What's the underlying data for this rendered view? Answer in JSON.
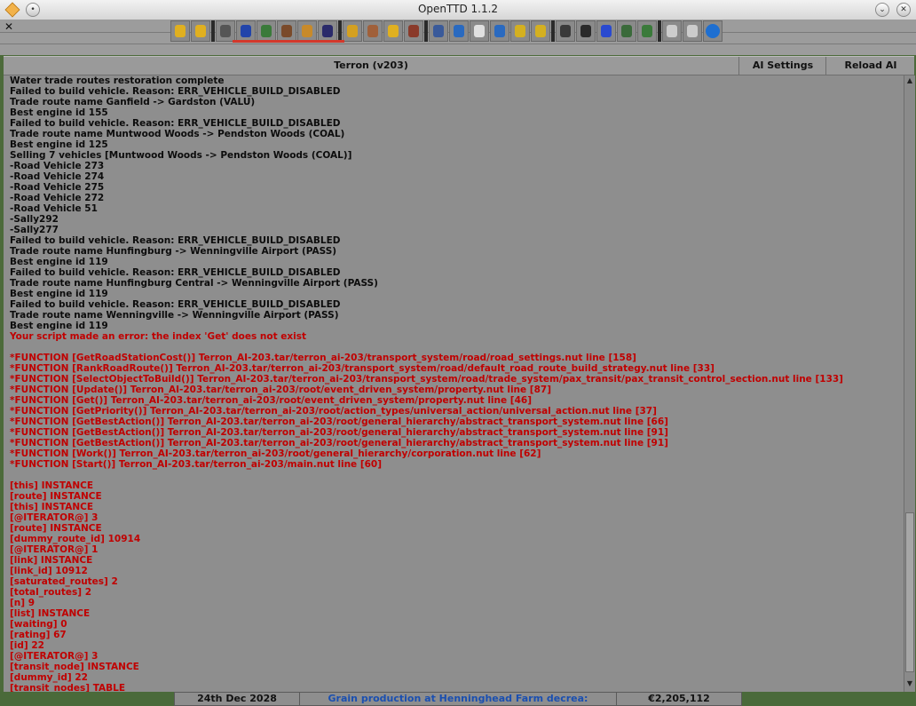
{
  "window": {
    "title": "OpenTTD 1.1.2"
  },
  "toolbar": {
    "icons": [
      {
        "name": "pause-icon",
        "color": "#e0b020"
      },
      {
        "name": "fast-forward-icon",
        "color": "#e0b020"
      },
      {
        "name": "settings-gear-icon",
        "color": "#555555"
      },
      {
        "name": "save-disk-icon",
        "color": "#2244aa"
      },
      {
        "name": "minimap-icon",
        "color": "#3a7a3a"
      },
      {
        "name": "town-directory-icon",
        "color": "#7a4a2a"
      },
      {
        "name": "subsidies-icon",
        "color": "#c88a2a"
      },
      {
        "name": "station-list-icon",
        "color": "#2a2a6a"
      },
      {
        "name": "finances-icon",
        "color": "#d4a020"
      },
      {
        "name": "company-face-icon",
        "color": "#a0603a"
      },
      {
        "name": "league-trophy-icon",
        "color": "#e0b020"
      },
      {
        "name": "industry-icon",
        "color": "#8a3a2a"
      },
      {
        "name": "train-list-icon",
        "color": "#3a5a9a"
      },
      {
        "name": "road-vehicle-list-icon",
        "color": "#2a6ac0"
      },
      {
        "name": "ship-list-icon",
        "color": "#e0e0e0"
      },
      {
        "name": "aircraft-list-icon",
        "color": "#2a6ac0"
      },
      {
        "name": "zoom-in-icon",
        "color": "#d4b020"
      },
      {
        "name": "zoom-out-icon",
        "color": "#d4b020"
      },
      {
        "name": "build-rail-icon",
        "color": "#3a3a3a"
      },
      {
        "name": "build-road-icon",
        "color": "#2a2a2a"
      },
      {
        "name": "build-water-icon",
        "color": "#2a4ad0"
      },
      {
        "name": "build-air-icon",
        "color": "#3a6a3a"
      },
      {
        "name": "landscaping-icon",
        "color": "#3a7a3a"
      },
      {
        "name": "music-icon",
        "color": "#cccccc"
      },
      {
        "name": "messages-icon",
        "color": "#cccccc"
      },
      {
        "name": "help-icon",
        "color": "#1e6fd1"
      }
    ]
  },
  "ai_debug": {
    "company_tab": "Terron (v203)",
    "ai_settings_label": "AI Settings",
    "reload_ai_label": "Reload AI",
    "log": [
      {
        "text": "Water trade routes restoration complete",
        "err": false
      },
      {
        "text": "Failed to build vehicle. Reason: ERR_VEHICLE_BUILD_DISABLED",
        "err": false
      },
      {
        "text": "Trade route name Ganfield -> Gardston (VALU)",
        "err": false
      },
      {
        "text": "Best engine id 155",
        "err": false
      },
      {
        "text": "Failed to build vehicle. Reason: ERR_VEHICLE_BUILD_DISABLED",
        "err": false
      },
      {
        "text": "Trade route name Muntwood Woods -> Pendston Woods (COAL)",
        "err": false
      },
      {
        "text": "Best engine id 125",
        "err": false
      },
      {
        "text": "Selling 7 vehicles [Muntwood Woods -> Pendston Woods (COAL)]",
        "err": false
      },
      {
        "text": "-Road Vehicle 273",
        "err": false
      },
      {
        "text": "-Road Vehicle 274",
        "err": false
      },
      {
        "text": "-Road Vehicle 275",
        "err": false
      },
      {
        "text": "-Road Vehicle 272",
        "err": false
      },
      {
        "text": "-Road Vehicle 51",
        "err": false
      },
      {
        "text": "-Sally292",
        "err": false
      },
      {
        "text": "-Sally277",
        "err": false
      },
      {
        "text": "Failed to build vehicle. Reason: ERR_VEHICLE_BUILD_DISABLED",
        "err": false
      },
      {
        "text": "Trade route name Hunfingburg -> Wenningville Airport (PASS)",
        "err": false
      },
      {
        "text": "Best engine id 119",
        "err": false
      },
      {
        "text": "Failed to build vehicle. Reason: ERR_VEHICLE_BUILD_DISABLED",
        "err": false
      },
      {
        "text": "Trade route name Hunfingburg Central -> Wenningville Airport (PASS)",
        "err": false
      },
      {
        "text": "Best engine id 119",
        "err": false
      },
      {
        "text": "Failed to build vehicle. Reason: ERR_VEHICLE_BUILD_DISABLED",
        "err": false
      },
      {
        "text": "Trade route name Wenningville -> Wenningville Airport (PASS)",
        "err": false
      },
      {
        "text": "Best engine id 119",
        "err": false
      },
      {
        "text": "Your script made an error: the index 'Get' does not exist",
        "err": true
      },
      {
        "text": "",
        "err": true
      },
      {
        "text": "*FUNCTION [GetRoadStationCost()] Terron_AI-203.tar/terron_ai-203/transport_system/road/road_settings.nut line [158]",
        "err": true
      },
      {
        "text": "*FUNCTION [RankRoadRoute()] Terron_AI-203.tar/terron_ai-203/transport_system/road/default_road_route_build_strategy.nut line [33]",
        "err": true
      },
      {
        "text": "*FUNCTION [SelectObjectToBuild()] Terron_AI-203.tar/terron_ai-203/transport_system/road/trade_system/pax_transit/pax_transit_control_section.nut line [133]",
        "err": true
      },
      {
        "text": "*FUNCTION [Update()] Terron_AI-203.tar/terron_ai-203/root/event_driven_system/property.nut line [87]",
        "err": true
      },
      {
        "text": "*FUNCTION [Get()] Terron_AI-203.tar/terron_ai-203/root/event_driven_system/property.nut line [46]",
        "err": true
      },
      {
        "text": "*FUNCTION [GetPriority()] Terron_AI-203.tar/terron_ai-203/root/action_types/universal_action/universal_action.nut line [37]",
        "err": true
      },
      {
        "text": "*FUNCTION [GetBestAction()] Terron_AI-203.tar/terron_ai-203/root/general_hierarchy/abstract_transport_system.nut line [66]",
        "err": true
      },
      {
        "text": "*FUNCTION [GetBestAction()] Terron_AI-203.tar/terron_ai-203/root/general_hierarchy/abstract_transport_system.nut line [91]",
        "err": true
      },
      {
        "text": "*FUNCTION [GetBestAction()] Terron_AI-203.tar/terron_ai-203/root/general_hierarchy/abstract_transport_system.nut line [91]",
        "err": true
      },
      {
        "text": "*FUNCTION [Work()] Terron_AI-203.tar/terron_ai-203/root/general_hierarchy/corporation.nut line [62]",
        "err": true
      },
      {
        "text": "*FUNCTION [Start()] Terron_AI-203.tar/terron_ai-203/main.nut line [60]",
        "err": true
      },
      {
        "text": "",
        "err": true
      },
      {
        "text": "[this] INSTANCE",
        "err": true
      },
      {
        "text": "[route] INSTANCE",
        "err": true
      },
      {
        "text": "[this] INSTANCE",
        "err": true
      },
      {
        "text": "[@ITERATOR@] 3",
        "err": true
      },
      {
        "text": "[route] INSTANCE",
        "err": true
      },
      {
        "text": "[dummy_route_id] 10914",
        "err": true
      },
      {
        "text": "[@ITERATOR@] 1",
        "err": true
      },
      {
        "text": "[link] INSTANCE",
        "err": true
      },
      {
        "text": "[link_id] 10912",
        "err": true
      },
      {
        "text": "[saturated_routes] 2",
        "err": true
      },
      {
        "text": "[total_routes] 2",
        "err": true
      },
      {
        "text": "[n] 9",
        "err": true
      },
      {
        "text": "[list] INSTANCE",
        "err": true
      },
      {
        "text": "[waiting] 0",
        "err": true
      },
      {
        "text": "[rating] 67",
        "err": true
      },
      {
        "text": "[id] 22",
        "err": true
      },
      {
        "text": "[@ITERATOR@] 3",
        "err": true
      },
      {
        "text": "[transit_node] INSTANCE",
        "err": true
      },
      {
        "text": "[dummy_id] 22",
        "err": true
      },
      {
        "text": "[transit_nodes] TABLE",
        "err": true
      }
    ]
  },
  "status": {
    "date": "24th Dec 2028",
    "news": "Grain production at Henninghead Farm decrea:",
    "money": "€2,205,112"
  }
}
